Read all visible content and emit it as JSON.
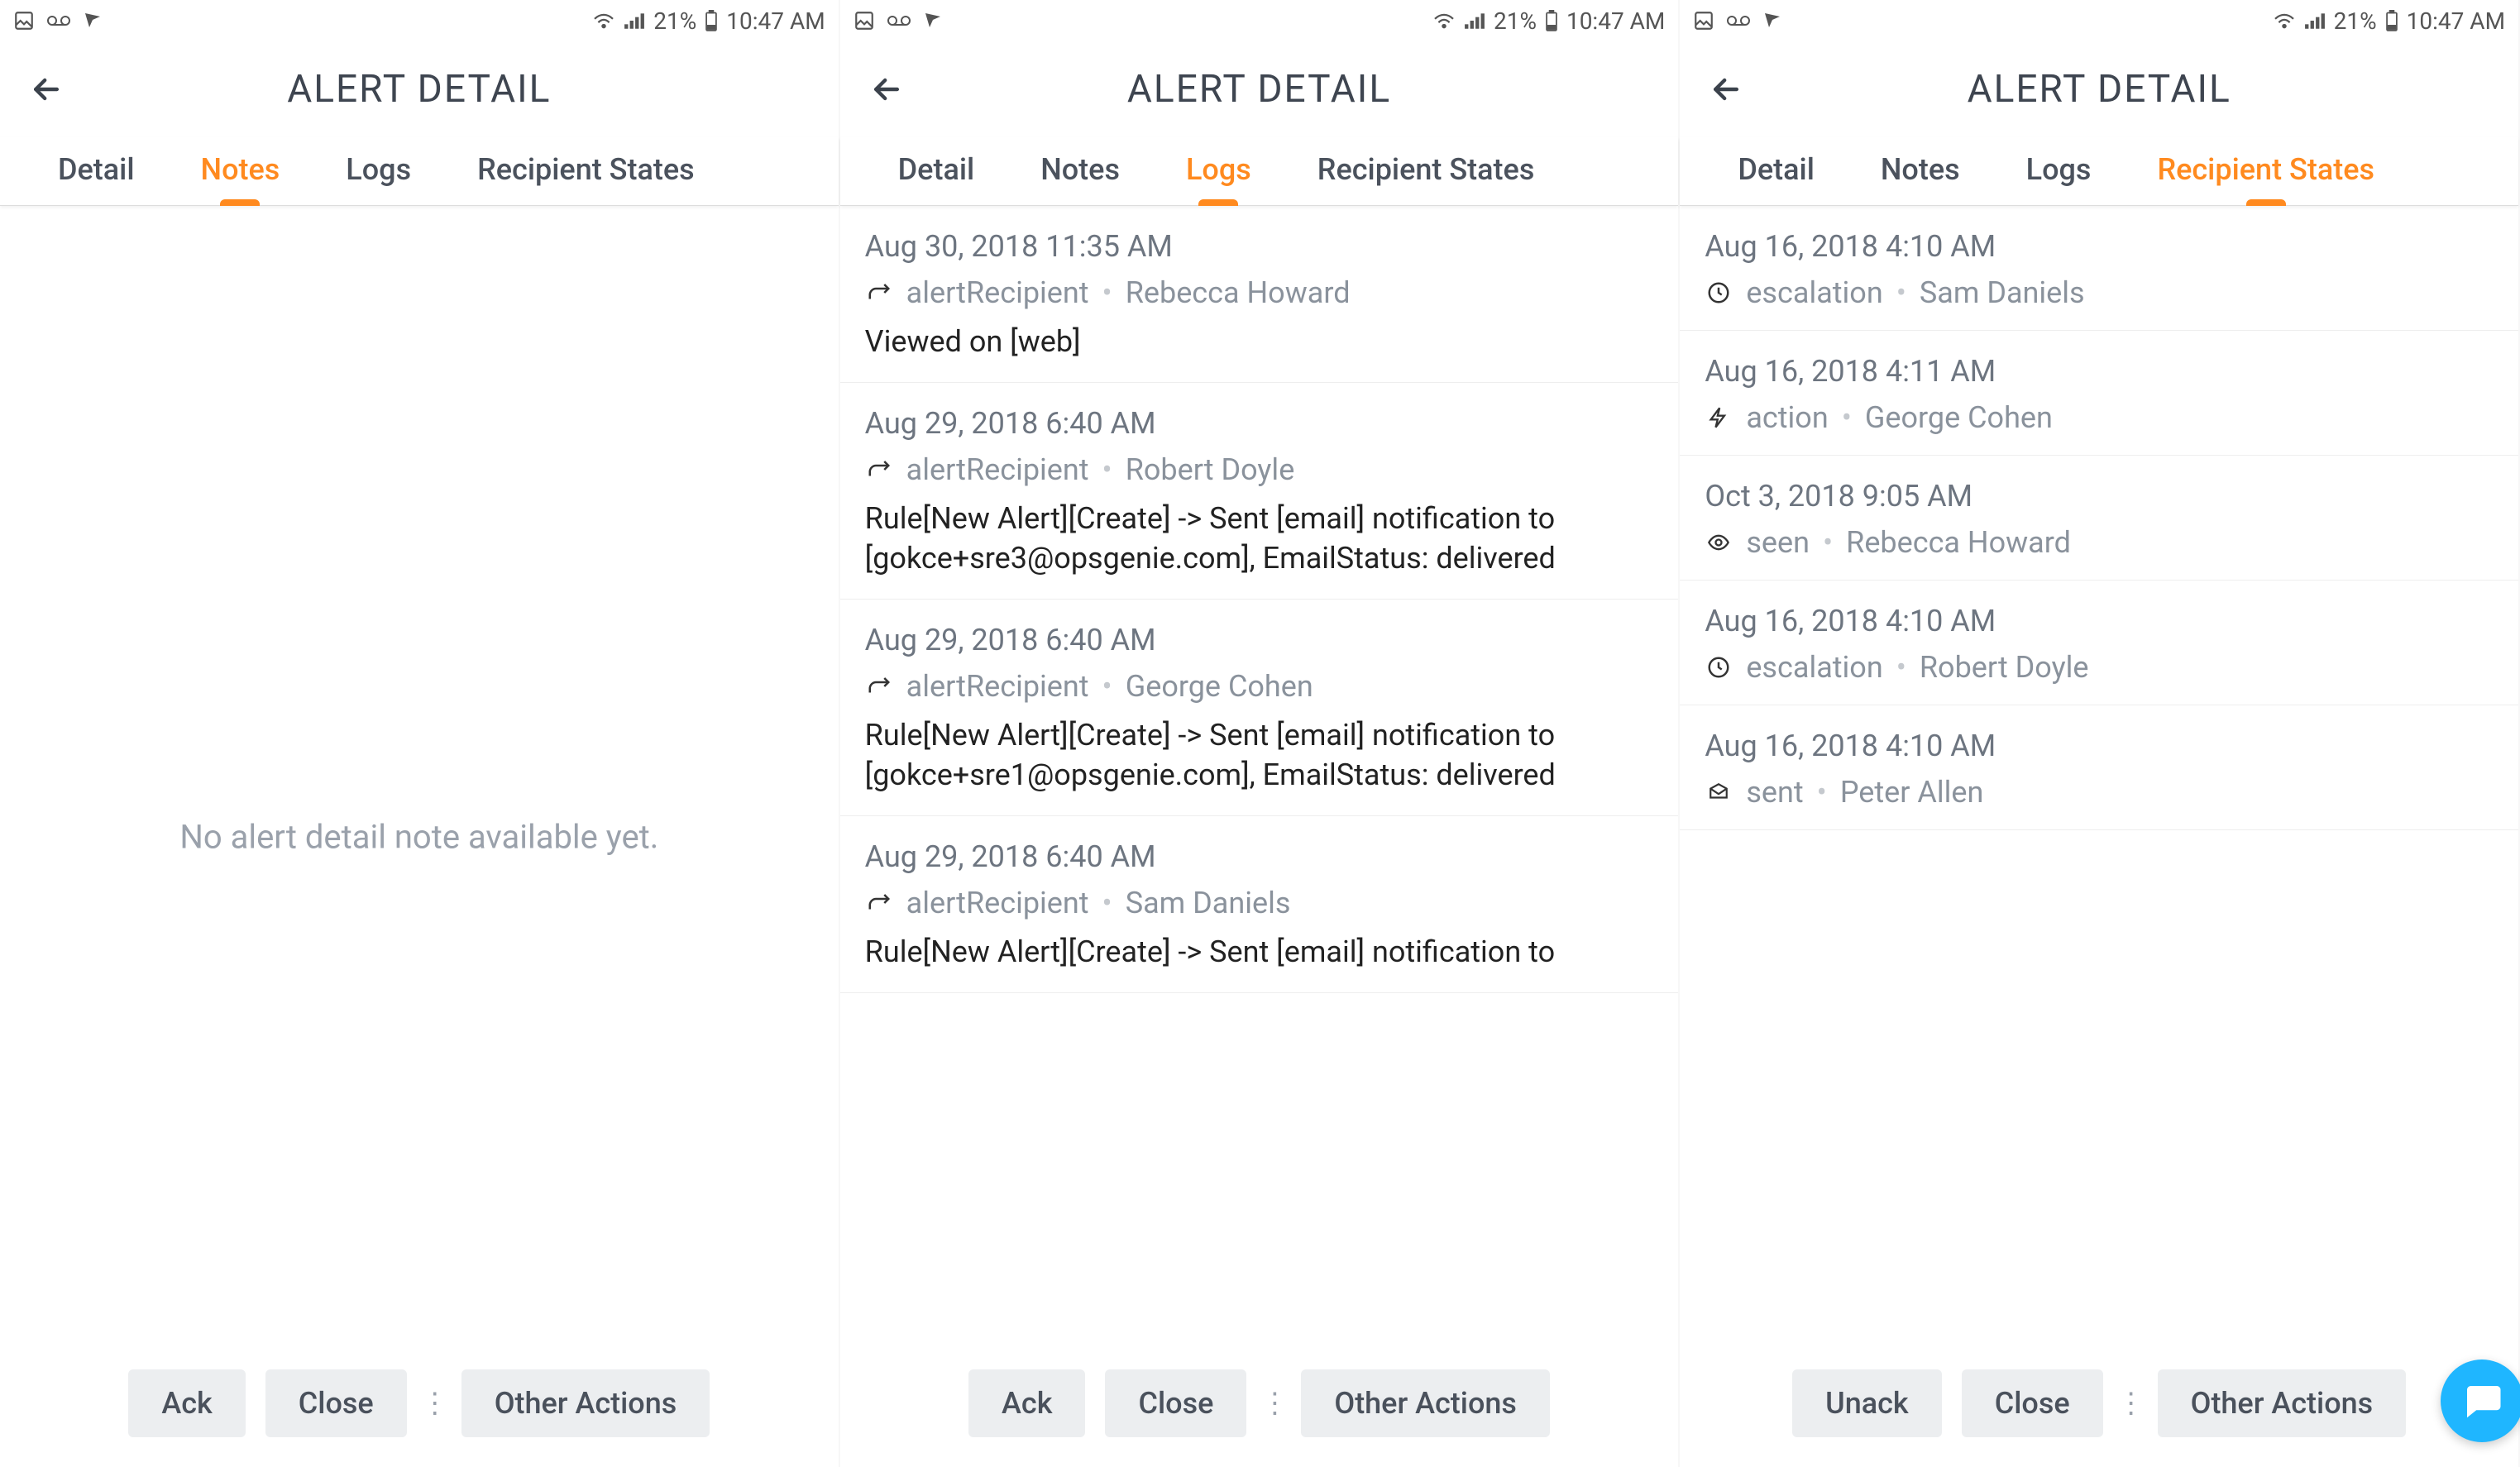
{
  "status": {
    "battery_pct": "21%",
    "time": "10:47 AM"
  },
  "header": {
    "title": "ALERT DETAIL"
  },
  "tabs": {
    "detail": "Detail",
    "notes": "Notes",
    "logs": "Logs",
    "recipient_states": "Recipient States"
  },
  "screens": [
    {
      "active_tab": "notes",
      "empty_message": "No alert detail note available yet.",
      "buttons": {
        "ack": "Ack",
        "close": "Close",
        "other": "Other Actions"
      }
    },
    {
      "active_tab": "logs",
      "buttons": {
        "ack": "Ack",
        "close": "Close",
        "other": "Other Actions"
      },
      "logs": [
        {
          "date": "Aug 30, 2018 11:35 AM",
          "icon": "recipient",
          "type": "alertRecipient",
          "person": "Rebecca Howard",
          "body": "Viewed on [web]"
        },
        {
          "date": "Aug 29, 2018 6:40 AM",
          "icon": "recipient",
          "type": "alertRecipient",
          "person": "Robert Doyle",
          "body": "Rule[New Alert][Create] -> Sent [email] notification to [gokce+sre3@opsgenie.com], EmailStatus: delivered"
        },
        {
          "date": "Aug 29, 2018 6:40 AM",
          "icon": "recipient",
          "type": "alertRecipient",
          "person": "George Cohen",
          "body": "Rule[New Alert][Create] -> Sent [email] notification to [gokce+sre1@opsgenie.com], EmailStatus: delivered"
        },
        {
          "date": "Aug 29, 2018 6:40 AM",
          "icon": "recipient",
          "type": "alertRecipient",
          "person": "Sam Daniels",
          "body": "Rule[New Alert][Create] -> Sent [email] notification to"
        }
      ]
    },
    {
      "active_tab": "recipient_states",
      "buttons": {
        "ack": "Unack",
        "close": "Close",
        "other": "Other Actions"
      },
      "states": [
        {
          "date": "Aug 16, 2018 4:10 AM",
          "icon": "clock",
          "type": "escalation",
          "person": "Sam Daniels"
        },
        {
          "date": "Aug 16, 2018 4:11 AM",
          "icon": "bolt",
          "type": "action",
          "person": "George Cohen"
        },
        {
          "date": "Oct 3, 2018 9:05 AM",
          "icon": "eye",
          "type": "seen",
          "person": "Rebecca Howard"
        },
        {
          "date": "Aug 16, 2018 4:10 AM",
          "icon": "clock",
          "type": "escalation",
          "person": "Robert Doyle"
        },
        {
          "date": "Aug 16, 2018 4:10 AM",
          "icon": "mail",
          "type": "sent",
          "person": "Peter Allen"
        }
      ]
    }
  ]
}
